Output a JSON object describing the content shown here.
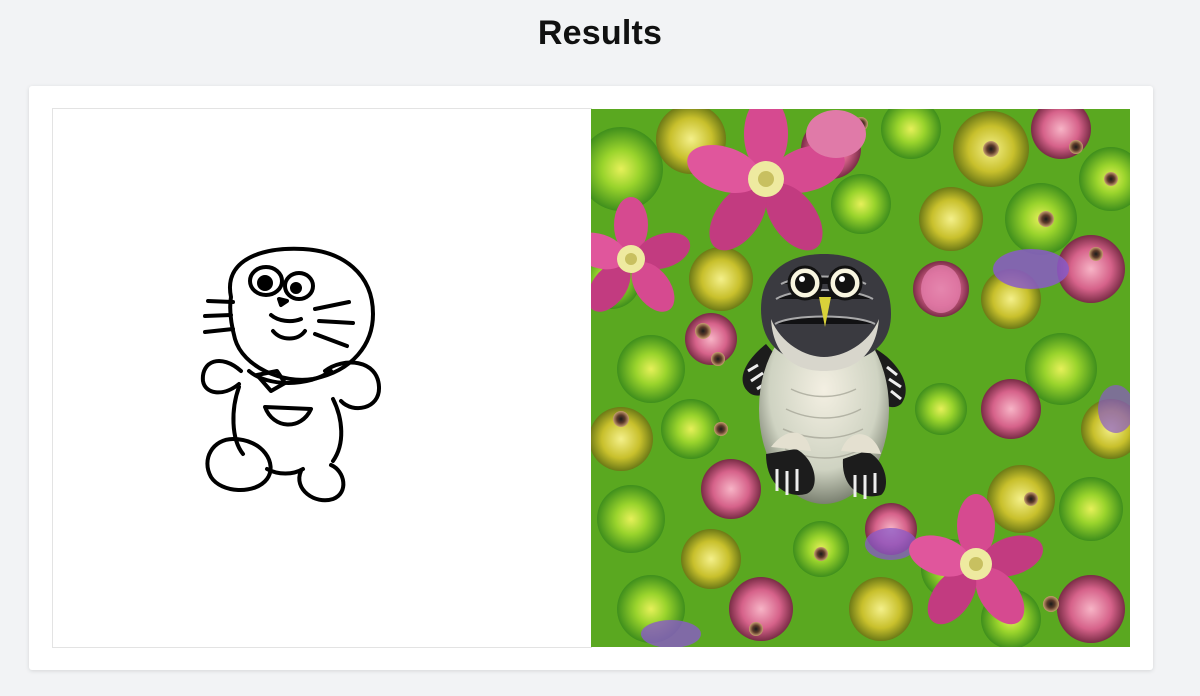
{
  "header": {
    "title": "Results"
  },
  "results": {
    "input_image_name": "input-sketch",
    "output_image_name": "generated-image"
  },
  "colors": {
    "page_background": "#f2f3f5",
    "card_background": "#ffffff",
    "sketch_stroke": "#000000",
    "generated_green": "#7ccf2a",
    "generated_pink": "#d84a8e",
    "generated_purple": "#8a5ac8"
  }
}
